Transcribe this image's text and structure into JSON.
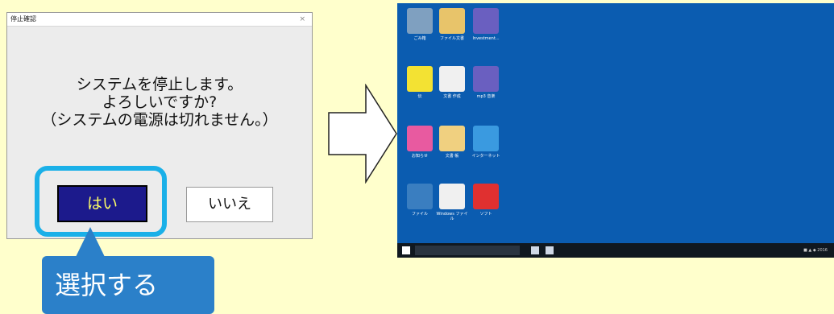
{
  "dialog": {
    "title": "停止確認",
    "close_label": "×",
    "message_line1": "システムを停止します。",
    "message_line2": "よろしいですか?",
    "message_line3": "（システムの電源は切れません。）",
    "yes_label": "はい",
    "no_label": "いいえ"
  },
  "callout": {
    "text": "選択する"
  },
  "desktop": {
    "icons": [
      {
        "label": "ごみ箱",
        "color": "#7fa0c0"
      },
      {
        "label": "ファイル文書",
        "color": "#e8c46a"
      },
      {
        "label": "Investment...",
        "color": "#6a5fc0"
      },
      {
        "label": "伝",
        "color": "#f3e233"
      },
      {
        "label": "文書 作成",
        "color": "#f0f0f0"
      },
      {
        "label": "mp3 音楽",
        "color": "#6a5fc0"
      },
      {
        "label": "お知らせ",
        "color": "#e85aa0"
      },
      {
        "label": "文書 帳",
        "color": "#f0d080"
      },
      {
        "label": "インターネット",
        "color": "#3a9ae0"
      },
      {
        "label": "ファイル",
        "color": "#3a7ec0"
      },
      {
        "label": "Windows ファイル",
        "color": "#f0f0f0"
      },
      {
        "label": "ソフト",
        "color": "#e03030"
      }
    ],
    "taskbar": {
      "tray_text": "■ ▲ ◆ 2016"
    }
  },
  "colors": {
    "background": "#ffffcc",
    "highlight": "#1ab0e8",
    "callout": "#2b80c9",
    "yes_button": "#1c1a8c",
    "desktop": "#0b5cb0"
  }
}
